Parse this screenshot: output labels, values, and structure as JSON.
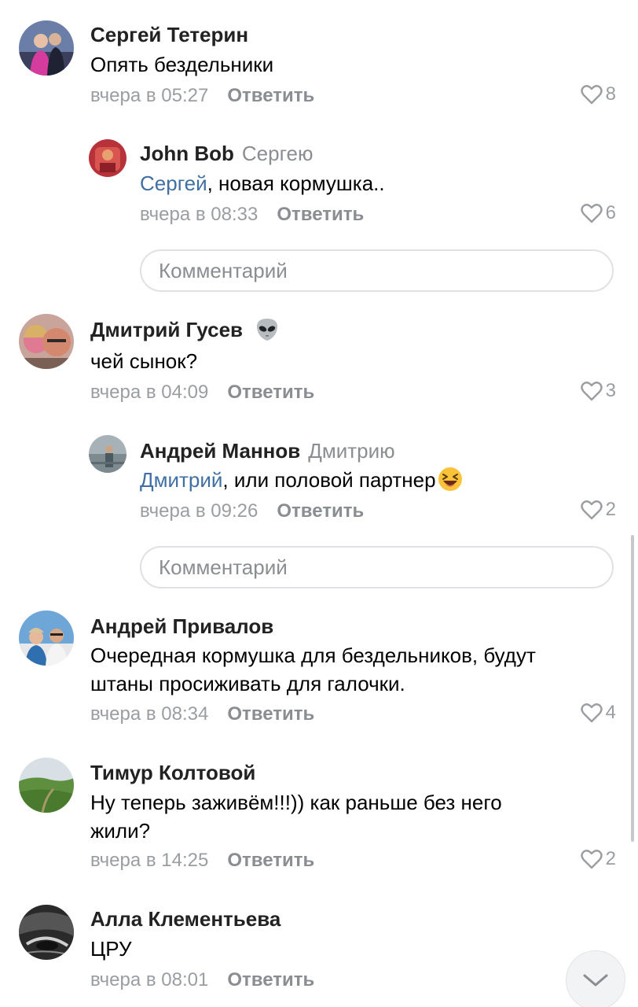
{
  "comments": [
    {
      "author": "Сергей Тетерин",
      "text": "Опять бездельники",
      "time": "вчера в 05:27",
      "reply_label": "Ответить",
      "likes": "8",
      "replies": [
        {
          "author": "John Bob",
          "reply_to": "Сергею",
          "mention": "Сергей",
          "text": ", новая кормушка..",
          "time": "вчера в 08:33",
          "reply_label": "Ответить",
          "likes": "6"
        }
      ],
      "input_placeholder": "Комментарий"
    },
    {
      "author": "Дмитрий Гусев",
      "author_badge_icon": "alien-emoji",
      "text": "чей сынок?",
      "time": "вчера в 04:09",
      "reply_label": "Ответить",
      "likes": "3",
      "replies": [
        {
          "author": "Андрей Маннов",
          "reply_to": "Дмитрию",
          "mention": "Дмитрий",
          "text": ", или половой партнер",
          "text_emoji": "laughing-emoji",
          "time": "вчера в 09:26",
          "reply_label": "Ответить",
          "likes": "2"
        }
      ],
      "input_placeholder": "Комментарий"
    },
    {
      "author": "Андрей Привалов",
      "text_line1": "Очередная кормушка для бездельников, будут",
      "text_line2": "штаны просиживать для галочки.",
      "time": "вчера в 08:34",
      "reply_label": "Ответить",
      "likes": "4"
    },
    {
      "author": "Тимур Колтовой",
      "text_line1": "Ну теперь заживём!!!)) как раньше без него",
      "text_line2": "жили?",
      "time": "вчера в 14:25",
      "reply_label": "Ответить",
      "likes": "2"
    },
    {
      "author": "Алла Клементьева",
      "text": "ЦРУ",
      "time": "вчера в 08:01",
      "reply_label": "Ответить"
    }
  ],
  "colors": {
    "mention": "#3f6fa3",
    "meta": "#9a9da1",
    "input_border": "#dfe1e5"
  }
}
